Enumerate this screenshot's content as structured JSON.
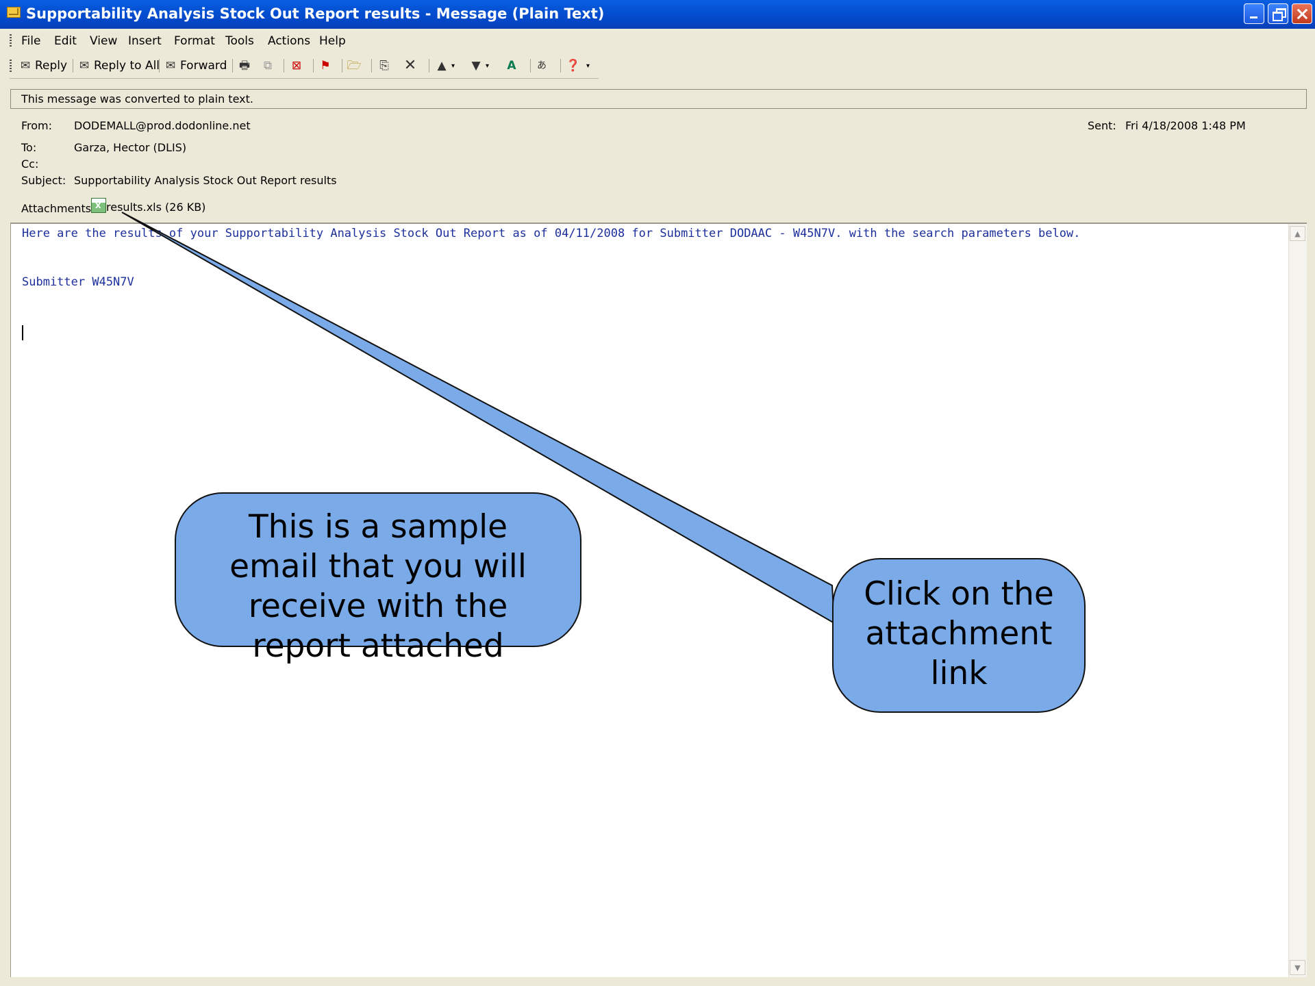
{
  "window": {
    "title": "Supportability Analysis Stock Out Report results - Message (Plain Text)"
  },
  "menu": [
    "File",
    "Edit",
    "View",
    "Insert",
    "Format",
    "Tools",
    "Actions",
    "Help"
  ],
  "toolbar": {
    "reply": "Reply",
    "reply_all": "Reply to All",
    "forward": "Forward"
  },
  "info_bar": "This message was converted to plain text.",
  "header": {
    "from_label": "From:",
    "from_value": "DODEMALL@prod.dodonline.net",
    "sent_label": "Sent:",
    "sent_value": "Fri 4/18/2008 1:48 PM",
    "to_label": "To:",
    "to_value": "Garza, Hector (DLIS)",
    "cc_label": "Cc:",
    "subject_label": "Subject:",
    "subject_value": "Supportability Analysis Stock Out Report results",
    "attachments_label": "Attachments:",
    "attachment_name": "results.xls (26 KB)"
  },
  "body": {
    "line1": "Here are the results of your Supportability Analysis Stock Out Report as of 04/11/2008 for Submitter DODAAC - W45N7V. with the search parameters below.",
    "line2": "Submitter W45N7V"
  },
  "callouts": {
    "sample": [
      "This is a sample",
      "email that you will",
      "receive with the",
      "report attached"
    ],
    "attachment": [
      "Click on the",
      "attachment",
      "link"
    ]
  },
  "colors": {
    "titlebar": "#0553d6",
    "chrome": "#ece9d8",
    "body_text": "#1c2f9c",
    "callout_fill": "#7aaae8"
  }
}
